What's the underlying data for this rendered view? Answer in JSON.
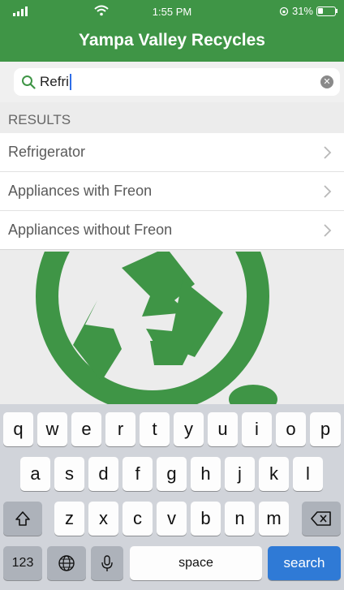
{
  "status": {
    "time": "1:55 PM",
    "battery": "31%",
    "battery_level": 0.31
  },
  "app": {
    "title": "Yampa Valley Recycles"
  },
  "search": {
    "value": "Refri",
    "icon": "search-icon",
    "clear_icon": "clear-icon"
  },
  "results": {
    "header": "RESULTS",
    "items": [
      {
        "label": "Refrigerator"
      },
      {
        "label": "Appliances with Freon"
      },
      {
        "label": "Appliances without Freon"
      }
    ]
  },
  "keyboard": {
    "row1": [
      "q",
      "w",
      "e",
      "r",
      "t",
      "y",
      "u",
      "i",
      "o",
      "p"
    ],
    "row2": [
      "a",
      "s",
      "d",
      "f",
      "g",
      "h",
      "j",
      "k",
      "l"
    ],
    "row3": [
      "z",
      "x",
      "c",
      "v",
      "b",
      "n",
      "m"
    ],
    "numbers_label": "123",
    "space_label": "space",
    "search_label": "search"
  },
  "colors": {
    "brand_green": "#3f9546",
    "search_blue": "#2f7ad6"
  }
}
